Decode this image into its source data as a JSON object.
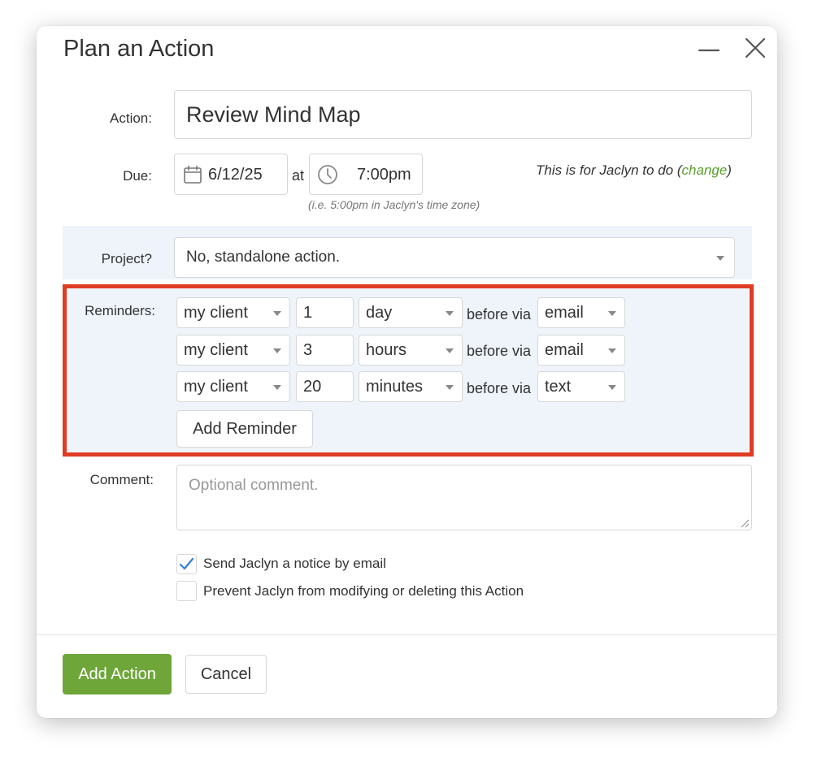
{
  "dialog": {
    "title": "Plan an Action"
  },
  "action": {
    "label": "Action:",
    "value": "Review Mind Map"
  },
  "due": {
    "label": "Due:",
    "date": "6/12/25",
    "at_label": "at",
    "time": "7:00pm",
    "timezone_hint": "(i.e. 5:00pm in Jaclyn's time zone)",
    "assignee_text": "This is for Jaclyn to do (",
    "change_link": "change",
    "assignee_close": ")"
  },
  "project": {
    "label": "Project?",
    "selected": "No, standalone action."
  },
  "reminders": {
    "label": "Reminders:",
    "before_via_label": "before via",
    "rows": [
      {
        "recipient": "my client",
        "amount": "1",
        "unit": "day",
        "channel": "email"
      },
      {
        "recipient": "my client",
        "amount": "3",
        "unit": "hours",
        "channel": "email"
      },
      {
        "recipient": "my client",
        "amount": "20",
        "unit": "minutes",
        "channel": "text"
      }
    ],
    "add_button": "Add Reminder",
    "highlight_color": "#e03b24"
  },
  "comment": {
    "label": "Comment:",
    "placeholder": "Optional comment."
  },
  "options": [
    {
      "label": "Send Jaclyn a notice by email",
      "checked": true
    },
    {
      "label": "Prevent Jaclyn from modifying or deleting this Action",
      "checked": false
    }
  ],
  "footer": {
    "primary": "Add Action",
    "cancel": "Cancel",
    "primary_color": "#6ea63a"
  },
  "icons": {
    "minimize": "minimize-icon",
    "close": "close-icon",
    "calendar": "calendar-icon",
    "clock": "clock-icon",
    "checkmark": "checkmark-icon",
    "dropdown": "chevron-down-icon",
    "resize": "resize-handle-icon"
  }
}
